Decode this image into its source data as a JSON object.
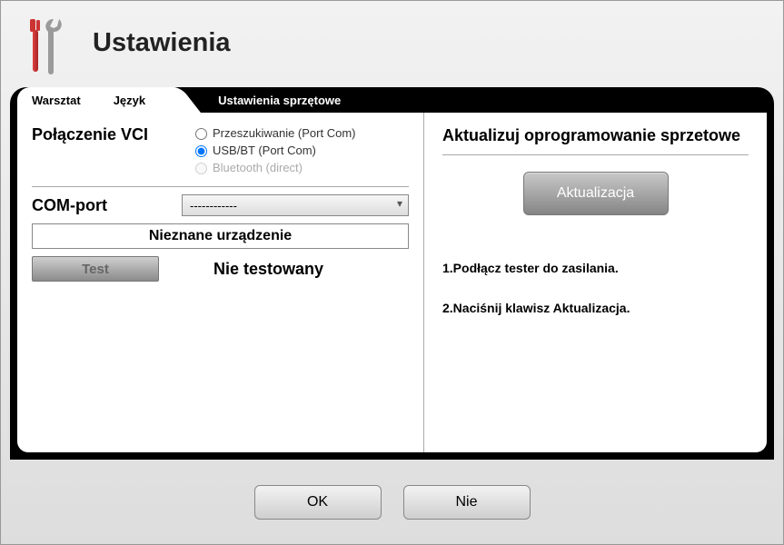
{
  "header": {
    "title": "Ustawienia"
  },
  "tabs": [
    {
      "label": "Warsztat"
    },
    {
      "label": "Język"
    },
    {
      "label": "Ustawienia sprzętowe"
    }
  ],
  "left": {
    "vci_title": "Połączenie VCI",
    "radios": {
      "scan": "Przeszukiwanie (Port Com)",
      "usbbt": "USB/BT (Port Com)",
      "bt": "Bluetooth (direct)"
    },
    "comport_label": "COM-port",
    "comport_value": "------------",
    "device_name": "Nieznane urządzenie",
    "test_btn": "Test",
    "test_status": "Nie testowany"
  },
  "right": {
    "title": "Aktualizuj oprogramowanie sprzetowe",
    "update_btn": "Aktualizacja",
    "step1": "1.Podłącz tester do zasilania.",
    "step2": "2.Naciśnij klawisz Aktualizacja."
  },
  "buttons": {
    "ok": "OK",
    "cancel": "Nie"
  }
}
